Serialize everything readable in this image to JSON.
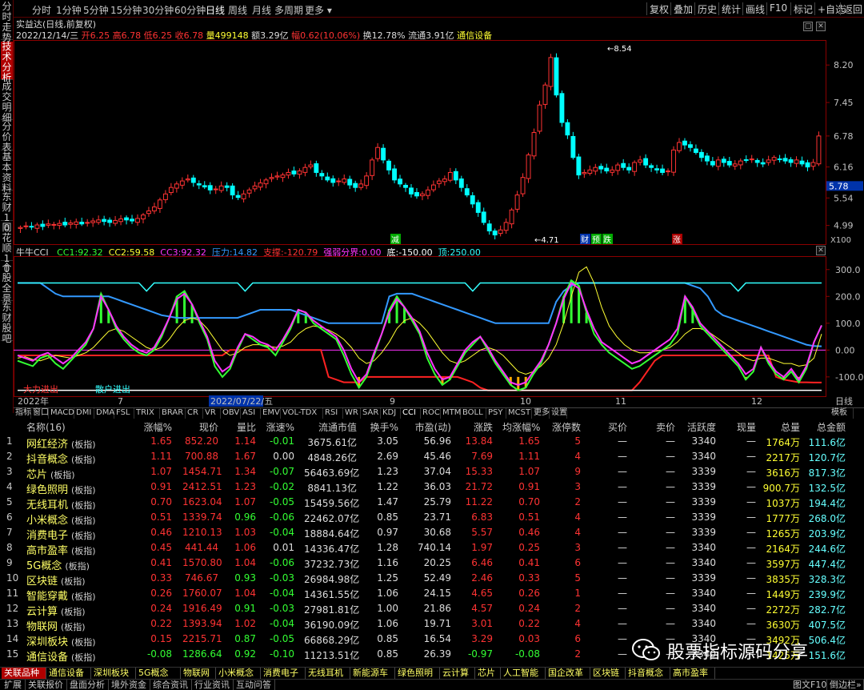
{
  "topbar": {
    "periods": [
      "分时",
      "1分钟",
      "5分钟",
      "15分钟",
      "30分钟",
      "60分钟",
      "日线",
      "周线",
      "月线",
      "多周期",
      "更多 ▾"
    ],
    "active_period": "日线",
    "tools": [
      "复权",
      "叠加",
      "历史",
      "统计",
      "画线",
      "F10",
      "标记",
      "+自选",
      "返回"
    ]
  },
  "left_tabs": [
    "分时走势",
    "技术分析",
    "成交明细",
    "分价表",
    "基本资料",
    "东财10",
    "同花顺10",
    "个股全景",
    "东财股吧"
  ],
  "left_active": "技术分析",
  "stock": {
    "title": "实益达(日线,前复权)",
    "date": "2022/12/14/三",
    "open_label": "开",
    "open": "6.25",
    "high_label": "高",
    "high": "6.78",
    "low_label": "低",
    "low": "6.25",
    "close_label": "收",
    "close": "6.78",
    "vol_label": "量",
    "vol": "499148",
    "amt_label": "额",
    "amt": "3.29亿",
    "chg_label": "幅",
    "chg": "0.62(10.06%)",
    "turn_label": "换",
    "turn": "12.78%",
    "float_label": "流通",
    "float": "3.91亿",
    "sector": "通信设备"
  },
  "indicator": {
    "name": "牛牛CCI",
    "items": [
      {
        "label": "CC1:",
        "value": "92.32",
        "color": "#33ff33"
      },
      {
        "label": "CC2:",
        "value": "59.58",
        "color": "#ffff33"
      },
      {
        "label": "CC3:",
        "value": "92.32",
        "color": "#ff33ff"
      },
      {
        "label": "压力:",
        "value": "14.82",
        "color": "#3399ff"
      },
      {
        "label": "支撑:",
        "value": "-120.79",
        "color": "#ff3333"
      },
      {
        "label": "强弱分界:",
        "value": "0.00",
        "color": "#ff33ff"
      },
      {
        "label": "底:",
        "value": "-150.00",
        "color": "#ffffff"
      },
      {
        "label": "顶:",
        "value": "250.00",
        "color": "#33ffff"
      }
    ],
    "labels": [
      "大力进出",
      "散户进出"
    ]
  },
  "chart_data": [
    {
      "type": "candlestick",
      "yticks": [
        "8.20",
        "7.45",
        "6.78",
        "6.16",
        "5.54",
        "4.99"
      ],
      "current_price_tag": "5.78",
      "annotations": {
        "peak": "8.54",
        "trough": "4.71",
        "marks": [
          "减",
          "财",
          "预",
          "跌",
          "涨"
        ]
      },
      "scale_label": "X100",
      "x_dates": [
        "2022年",
        "7",
        "2022/07/22/五",
        "9",
        "10",
        "11",
        "12"
      ],
      "period_label": "日线",
      "closes": [
        4.95,
        4.98,
        4.96,
        5.0,
        4.97,
        5.02,
        5.01,
        5.03,
        5.0,
        5.04,
        5.06,
        5.02,
        5.05,
        5.08,
        5.1,
        5.07,
        5.05,
        5.09,
        5.12,
        5.1,
        5.08,
        5.13,
        5.2,
        5.28,
        5.36,
        5.5,
        5.62,
        5.75,
        5.82,
        5.88,
        5.92,
        5.85,
        5.8,
        5.76,
        5.7,
        5.72,
        5.78,
        5.75,
        5.6,
        5.55,
        5.62,
        5.7,
        5.78,
        5.84,
        5.9,
        5.95,
        5.98,
        6.0,
        6.05,
        6.02,
        6.08,
        6.15,
        6.2,
        6.05,
        5.98,
        5.9,
        5.85,
        5.88,
        5.92,
        5.8,
        5.75,
        5.82,
        5.98,
        6.3,
        6.55,
        6.3,
        6.1,
        5.9,
        5.82,
        5.75,
        5.62,
        5.58,
        5.62,
        5.7,
        5.8,
        5.88,
        5.92,
        6.05,
        5.9,
        5.75,
        5.6,
        5.42,
        5.25,
        5.05,
        4.88,
        4.8,
        4.9,
        5.05,
        5.3,
        5.6,
        5.95,
        6.4,
        6.85,
        7.4,
        7.8,
        8.35,
        7.6,
        7.05,
        6.8,
        6.35,
        6.0,
        6.05,
        6.1,
        6.15,
        6.12,
        6.08,
        6.1,
        6.2,
        6.15,
        6.1,
        6.25,
        6.3,
        6.2,
        6.15,
        6.1,
        6.05,
        6.08,
        6.5,
        6.65,
        6.6,
        6.55,
        6.45,
        6.35,
        6.28,
        6.2,
        6.3,
        6.25,
        6.2,
        6.22,
        6.28,
        6.3,
        6.32,
        6.25,
        6.22,
        6.3,
        6.35,
        6.32,
        6.28,
        6.25,
        6.3,
        6.22,
        6.16,
        6.25,
        6.78
      ],
      "volume_hint": "daily candles, red=up, cyan=down"
    },
    {
      "type": "line",
      "name": "牛牛CCI",
      "yticks": [
        "300.0",
        "200.0",
        "100.0",
        "0.00",
        "-100.0"
      ],
      "ylim": [
        -175,
        350
      ],
      "series": [
        {
          "name": "CC1",
          "color": "#33ff33"
        },
        {
          "name": "CC2",
          "color": "#ffff33"
        },
        {
          "name": "CC3",
          "color": "#ff33ff"
        },
        {
          "name": "压力",
          "color": "#3399ff"
        },
        {
          "name": "支撑",
          "color": "#ff3333"
        },
        {
          "name": "顶",
          "color": "#33ffff"
        },
        {
          "name": "底",
          "color": "#ffffff"
        }
      ],
      "cc1": [
        -40,
        -50,
        -60,
        -30,
        -20,
        -50,
        -70,
        -40,
        -10,
        20,
        80,
        210,
        150,
        80,
        40,
        10,
        -10,
        -20,
        0,
        50,
        120,
        200,
        220,
        170,
        100,
        40,
        -60,
        -100,
        -70,
        0,
        60,
        40,
        20,
        10,
        -20,
        30,
        80,
        150,
        140,
        100,
        80,
        60,
        40,
        -20,
        -90,
        -140,
        -100,
        -20,
        60,
        150,
        200,
        160,
        110,
        60,
        -30,
        -90,
        -130,
        -110,
        -60,
        -10,
        20,
        50,
        0,
        -50,
        -90,
        -130,
        -150,
        -140,
        -90,
        -50,
        20,
        100,
        200,
        260,
        240,
        140,
        60,
        20,
        -10,
        -30,
        -50,
        -70,
        -60,
        -40,
        -20,
        0,
        20,
        60,
        200,
        150,
        90,
        60,
        30,
        0,
        -30,
        -60,
        -110,
        -80,
        10,
        -50,
        -90,
        -110,
        -80,
        -120,
        -70,
        30,
        92
      ],
      "cc3": [
        -20,
        -30,
        -40,
        -20,
        -10,
        -30,
        -50,
        -30,
        0,
        30,
        80,
        200,
        150,
        90,
        50,
        20,
        0,
        -10,
        10,
        60,
        120,
        190,
        210,
        170,
        110,
        50,
        -40,
        -80,
        -60,
        10,
        60,
        50,
        30,
        20,
        0,
        40,
        90,
        150,
        140,
        110,
        90,
        70,
        50,
        0,
        -70,
        -120,
        -90,
        -10,
        60,
        140,
        190,
        160,
        120,
        70,
        -10,
        -70,
        -110,
        -100,
        -50,
        0,
        30,
        50,
        10,
        -40,
        -80,
        -120,
        -130,
        -120,
        -80,
        -40,
        20,
        100,
        190,
        250,
        230,
        150,
        80,
        30,
        10,
        -10,
        -30,
        -50,
        -40,
        -20,
        0,
        20,
        40,
        80,
        200,
        160,
        100,
        70,
        40,
        10,
        -20,
        -50,
        -90,
        -70,
        10,
        -40,
        -80,
        -100,
        -70,
        -110,
        -60,
        30,
        92
      ],
      "cc2": [
        -30,
        -25,
        -35,
        -40,
        -30,
        -20,
        -25,
        -30,
        -20,
        -10,
        10,
        40,
        70,
        80,
        70,
        50,
        30,
        10,
        0,
        10,
        40,
        80,
        110,
        120,
        110,
        80,
        40,
        0,
        -20,
        -10,
        10,
        20,
        20,
        15,
        10,
        15,
        30,
        60,
        80,
        90,
        85,
        75,
        60,
        40,
        10,
        -30,
        -50,
        -40,
        -10,
        30,
        80,
        110,
        120,
        100,
        70,
        30,
        -10,
        -40,
        -50,
        -40,
        -20,
        0,
        10,
        0,
        -20,
        -50,
        -80,
        -90,
        -80,
        -60,
        -30,
        20,
        100,
        200,
        290,
        310,
        250,
        160,
        90,
        50,
        20,
        0,
        -10,
        -10,
        -5,
        0,
        10,
        30,
        60,
        80,
        80,
        70,
        50,
        30,
        10,
        -10,
        -30,
        -40,
        -30,
        -30,
        -40,
        -50,
        -50,
        -60,
        -55,
        -30,
        60
      ],
      "pressure": [
        250,
        250,
        250,
        250,
        230,
        210,
        200,
        200,
        200,
        200,
        200,
        200,
        200,
        190,
        180,
        170,
        160,
        150,
        140,
        130,
        125,
        120,
        120,
        120,
        120,
        120,
        120,
        120,
        120,
        120,
        130,
        140,
        150,
        150,
        150,
        150,
        150,
        140,
        130,
        120,
        110,
        100,
        100,
        100,
        100,
        100,
        100,
        100,
        100,
        200,
        210,
        210,
        210,
        200,
        190,
        180,
        170,
        160,
        150,
        140,
        130,
        120,
        110,
        100,
        100,
        100,
        100,
        100,
        100,
        100,
        100,
        180,
        220,
        240,
        250,
        250,
        250,
        250,
        250,
        250,
        250,
        250,
        250,
        250,
        250,
        250,
        250,
        250,
        250,
        240,
        230,
        200,
        150,
        130,
        120,
        110,
        100,
        90,
        80,
        70,
        60,
        50,
        40,
        30,
        20,
        15,
        14
      ],
      "support": [
        -20,
        -20,
        -20,
        -20,
        -20,
        -20,
        -20,
        -20,
        -20,
        -20,
        -20,
        -20,
        -20,
        -20,
        -20,
        -20,
        -20,
        -20,
        -20,
        -20,
        -20,
        -20,
        -20,
        -20,
        -20,
        -20,
        -20,
        -20,
        0,
        0,
        0,
        0,
        0,
        0,
        0,
        0,
        0,
        0,
        0,
        0,
        0,
        -100,
        -110,
        -120,
        -120,
        -120,
        -100,
        -100,
        -100,
        -100,
        -100,
        -100,
        -100,
        -100,
        -100,
        -100,
        -100,
        -100,
        -100,
        -110,
        -120,
        -140,
        -150,
        -150,
        -150,
        -150,
        -150,
        -150,
        -150,
        -150,
        -150,
        -150,
        -150,
        -150,
        -150,
        -150,
        -150,
        -150,
        -150,
        -150,
        -150,
        -150,
        -120,
        -80,
        -40,
        -20,
        -20,
        -20,
        -20,
        -20,
        -20,
        -20,
        -20,
        -20,
        -20,
        -20,
        -20,
        -20,
        -20,
        -20,
        -100,
        -110,
        -115,
        -120,
        -120,
        -121,
        -121
      ]
    }
  ],
  "indicator_tabs": [
    "指标",
    "窗口",
    "MACD",
    "DMI",
    "DMA",
    "FSL",
    "TRIX",
    "BRAR",
    "CR",
    "VR",
    "OBV",
    "ASI",
    "EMV",
    "VOL-TDX",
    "RSI",
    "WR",
    "SAR",
    "KDJ",
    "CCI",
    "ROC",
    "MTM",
    "BOLL",
    "PSY",
    "MCST",
    "更多",
    "设置"
  ],
  "indicator_tab_right": "模板",
  "table": {
    "headers": [
      "名称(16)",
      "涨幅%",
      "现价",
      "量比",
      "涨速%",
      "流通市值",
      "换手%",
      "市盈(动)",
      "涨跌",
      "均涨幅%",
      "涨停数",
      "买价",
      "卖价",
      "活跃度",
      "现量",
      "总量",
      "总金额"
    ],
    "rows": [
      [
        "1",
        "网红经济",
        "板指",
        "1.65",
        "852.20",
        "1.14",
        "-0.01",
        "3675.61亿",
        "3.05",
        "56.96",
        "13.84",
        "1.65",
        "5",
        "—",
        "—",
        "3340",
        "—",
        "1764万",
        "111.6亿"
      ],
      [
        "2",
        "抖音概念",
        "板指",
        "1.11",
        "700.88",
        "1.67",
        "0.00",
        "4848.26亿",
        "2.69",
        "45.46",
        "7.69",
        "1.11",
        "4",
        "—",
        "—",
        "3340",
        "—",
        "2217万",
        "120.7亿"
      ],
      [
        "3",
        "芯片",
        "板指",
        "1.07",
        "1454.71",
        "1.34",
        "-0.07",
        "56463.69亿",
        "1.23",
        "37.04",
        "15.33",
        "1.07",
        "9",
        "—",
        "—",
        "3339",
        "—",
        "3616万",
        "817.3亿"
      ],
      [
        "4",
        "绿色照明",
        "板指",
        "0.91",
        "2412.51",
        "1.23",
        "-0.02",
        "8841.13亿",
        "1.22",
        "36.03",
        "21.72",
        "0.91",
        "3",
        "—",
        "—",
        "3339",
        "—",
        "900.7万",
        "132.5亿"
      ],
      [
        "5",
        "无线耳机",
        "板指",
        "0.70",
        "1623.04",
        "1.07",
        "-0.05",
        "15459.56亿",
        "1.47",
        "25.79",
        "11.22",
        "0.70",
        "2",
        "—",
        "—",
        "3339",
        "—",
        "1037万",
        "194.4亿"
      ],
      [
        "6",
        "小米概念",
        "板指",
        "0.51",
        "1339.74",
        "0.96",
        "-0.06",
        "22462.07亿",
        "0.85",
        "23.71",
        "6.83",
        "0.51",
        "4",
        "—",
        "—",
        "3339",
        "—",
        "1777万",
        "268.0亿"
      ],
      [
        "7",
        "消费电子",
        "板指",
        "0.46",
        "1210.13",
        "1.03",
        "-0.04",
        "18884.64亿",
        "0.97",
        "30.68",
        "5.57",
        "0.46",
        "4",
        "—",
        "—",
        "3339",
        "—",
        "1265万",
        "203.9亿"
      ],
      [
        "8",
        "高市盈率",
        "板指",
        "0.45",
        "441.44",
        "1.06",
        "0.01",
        "14336.47亿",
        "1.28",
        "740.14",
        "1.97",
        "0.25",
        "3",
        "—",
        "—",
        "3340",
        "—",
        "2164万",
        "244.6亿"
      ],
      [
        "9",
        "5G概念",
        "板指",
        "0.41",
        "1570.80",
        "1.04",
        "-0.06",
        "37232.73亿",
        "1.16",
        "20.25",
        "6.46",
        "0.41",
        "6",
        "—",
        "—",
        "3340",
        "—",
        "3597万",
        "447.4亿"
      ],
      [
        "10",
        "区块链",
        "板指",
        "0.33",
        "746.67",
        "0.93",
        "-0.03",
        "26984.98亿",
        "1.25",
        "52.49",
        "2.46",
        "0.33",
        "5",
        "—",
        "—",
        "3339",
        "—",
        "3835万",
        "328.3亿"
      ],
      [
        "11",
        "智能穿戴",
        "板指",
        "0.26",
        "1760.07",
        "1.04",
        "-0.04",
        "14361.55亿",
        "1.06",
        "24.15",
        "4.65",
        "0.26",
        "1",
        "—",
        "—",
        "3340",
        "—",
        "1449万",
        "239.9亿"
      ],
      [
        "12",
        "云计算",
        "板指",
        "0.24",
        "1916.49",
        "0.91",
        "-0.03",
        "27981.81亿",
        "1.00",
        "21.86",
        "4.57",
        "0.24",
        "2",
        "—",
        "—",
        "3340",
        "—",
        "2272万",
        "282.7亿"
      ],
      [
        "13",
        "物联网",
        "板指",
        "0.22",
        "1393.94",
        "1.02",
        "-0.04",
        "36190.09亿",
        "1.06",
        "19.71",
        "3.01",
        "0.22",
        "4",
        "—",
        "—",
        "3340",
        "—",
        "3630万",
        "407.5亿"
      ],
      [
        "14",
        "深圳板块",
        "板指",
        "0.15",
        "2215.71",
        "0.87",
        "-0.05",
        "66868.29亿",
        "0.85",
        "16.54",
        "3.29",
        "0.03",
        "6",
        "—",
        "—",
        "3340",
        "—",
        "3492万",
        "506.4亿"
      ],
      [
        "15",
        "通信设备",
        "板指",
        "-0.08",
        "1286.64",
        "0.92",
        "-0.10",
        "11213.51亿",
        "0.85",
        "26.39",
        "-0.97",
        "-0.08",
        "2",
        "—",
        "—",
        "3340",
        "—",
        "1425万",
        "151.6亿"
      ]
    ]
  },
  "bottom_tabs": [
    "关联品种",
    "通信设备",
    "深圳板块",
    "5G概念",
    "物联网",
    "小米概念",
    "消费电子",
    "无线耳机",
    "新能源车",
    "绿色照明",
    "云计算",
    "芯片",
    "人工智能",
    "国企改革",
    "区块链",
    "抖音概念",
    "高市盈率"
  ],
  "bottom_active": "关联品种",
  "statusbar": [
    "扩展",
    "关联报价",
    "盘面分析",
    "境外资金",
    "综合资讯",
    "行业资讯",
    "互动问答"
  ],
  "statusbar_right": [
    "图文F10",
    "倒边栏»"
  ],
  "watermark": {
    "text": "股票指标源码分享",
    "icon": "wechat-icon"
  }
}
